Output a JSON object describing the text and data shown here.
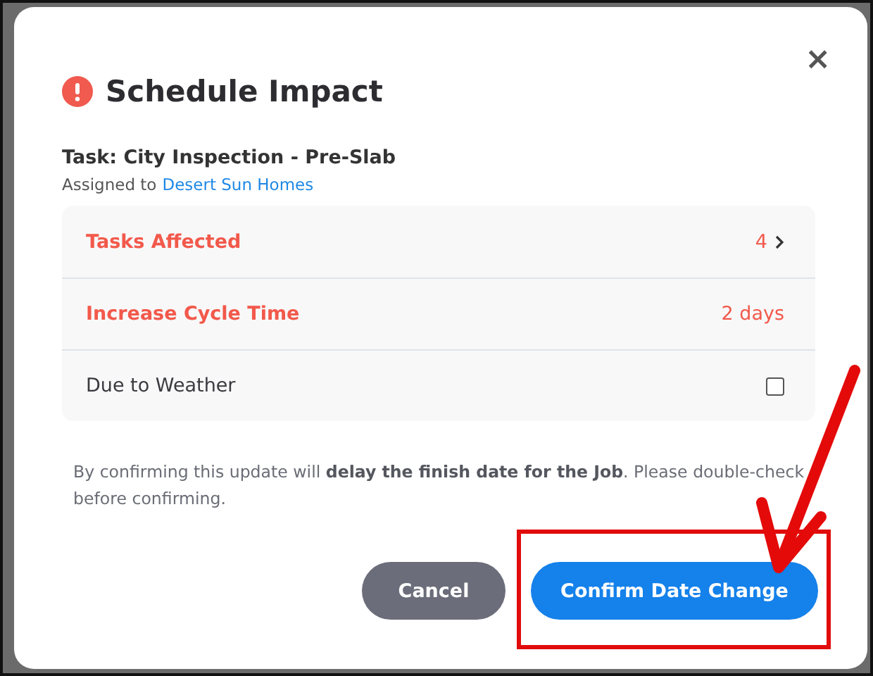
{
  "dialog": {
    "title": "Schedule Impact",
    "close": "×",
    "task": "Task: City Inspection - Pre-Slab",
    "assigned_prefix": "Assigned to",
    "assignee": "Desert Sun Homes"
  },
  "impact_rows": [
    {
      "kind": "link",
      "label": "Tasks Affected",
      "value": "4"
    },
    {
      "kind": "value",
      "label": "Increase Cycle Time",
      "value": "2 days"
    },
    {
      "kind": "checkbox",
      "label": "Due to Weather",
      "checked": false
    }
  ],
  "note": "By confirming this update will **delay the finish date for the Job**. Please double-check before confirming.",
  "buttons": [
    {
      "kind": "secondary",
      "label": "Cancel",
      "highlighted": false
    },
    {
      "kind": "primary",
      "label": "Confirm Date Change",
      "highlighted": true
    }
  ]
}
